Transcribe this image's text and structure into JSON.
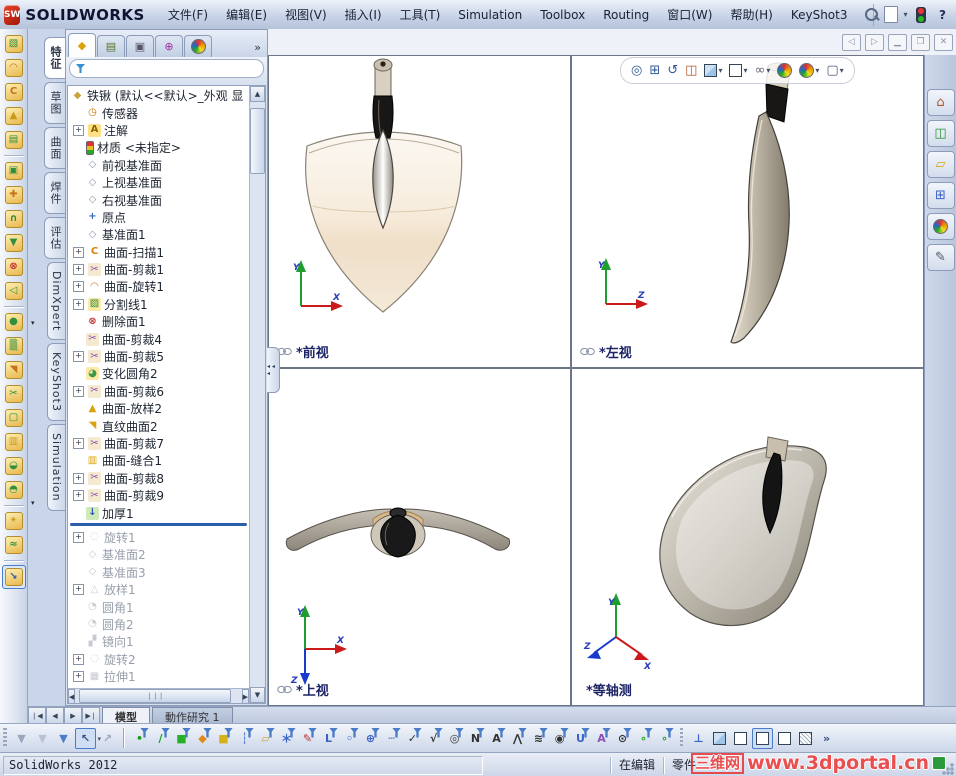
{
  "titlebar": {
    "logo_text": "SW",
    "brand": "SOLIDWORKS",
    "menus": [
      "文件(F)",
      "编辑(E)",
      "视图(V)",
      "插入(I)",
      "工具(T)",
      "Simulation",
      "Toolbox",
      "Routing",
      "窗口(W)",
      "帮助(H)",
      "KeyShot3"
    ],
    "quick_icons": [
      "search",
      "new-document",
      "connection-status",
      "help"
    ],
    "window_buttons": [
      "minimize",
      "restore",
      "close"
    ]
  },
  "command_tabs": {
    "items": [
      {
        "label": "特征",
        "active": true
      },
      {
        "label": "草图",
        "active": false
      },
      {
        "label": "曲面",
        "active": false
      },
      {
        "label": "焊件",
        "active": false
      },
      {
        "label": "评估",
        "active": false
      },
      {
        "label": "DimXpert",
        "active": false
      },
      {
        "label": "KeyShot3",
        "active": false
      },
      {
        "label": "Simulation",
        "active": false
      }
    ]
  },
  "manager_tabs": {
    "icons": [
      "featuremanager",
      "propertymanager",
      "configurationmanager",
      "dimxpertmanager",
      "displaymanager"
    ],
    "overflow": "»"
  },
  "filter": {
    "value": ""
  },
  "feature_tree": {
    "root": "铁锹  (默认<<默认>_外观 显",
    "rollback_index": 24,
    "items": [
      {
        "label": "传感器",
        "icon": "sensor"
      },
      {
        "label": "注解",
        "icon": "annotation",
        "expand": true
      },
      {
        "label": "材质 <未指定>",
        "icon": "material"
      },
      {
        "label": "前视基准面",
        "icon": "plane"
      },
      {
        "label": "上视基准面",
        "icon": "plane"
      },
      {
        "label": "右视基准面",
        "icon": "plane"
      },
      {
        "label": "原点",
        "icon": "origin"
      },
      {
        "label": "基准面1",
        "icon": "plane"
      },
      {
        "label": "曲面-扫描1",
        "icon": "sweep",
        "expand": true
      },
      {
        "label": "曲面-剪裁1",
        "icon": "trim",
        "expand": true
      },
      {
        "label": "曲面-旋转1",
        "icon": "revolve",
        "expand": true
      },
      {
        "label": "分割线1",
        "icon": "splitline",
        "expand": true
      },
      {
        "label": "删除面1",
        "icon": "delete-face"
      },
      {
        "label": "曲面-剪裁4",
        "icon": "trim"
      },
      {
        "label": "曲面-剪裁5",
        "icon": "trim",
        "expand": true
      },
      {
        "label": "变化圆角2",
        "icon": "fillet"
      },
      {
        "label": "曲面-剪裁6",
        "icon": "trim",
        "expand": true
      },
      {
        "label": "曲面-放样2",
        "icon": "loft"
      },
      {
        "label": "直纹曲面2",
        "icon": "ruled"
      },
      {
        "label": "曲面-剪裁7",
        "icon": "trim",
        "expand": true
      },
      {
        "label": "曲面-缝合1",
        "icon": "knit"
      },
      {
        "label": "曲面-剪裁8",
        "icon": "trim",
        "expand": true
      },
      {
        "label": "曲面-剪裁9",
        "icon": "trim",
        "expand": true
      },
      {
        "label": "加厚1",
        "icon": "thicken"
      },
      {
        "label": "旋转1",
        "icon": "revolve2",
        "expand": true,
        "gray": true
      },
      {
        "label": "基准面2",
        "icon": "plane",
        "gray": true
      },
      {
        "label": "基准面3",
        "icon": "plane",
        "gray": true
      },
      {
        "label": "放样1",
        "icon": "loft2",
        "expand": true,
        "gray": true
      },
      {
        "label": "圆角1",
        "icon": "fillet2",
        "gray": true
      },
      {
        "label": "圆角2",
        "icon": "fillet2",
        "gray": true
      },
      {
        "label": "镜向1",
        "icon": "mirror",
        "gray": true
      },
      {
        "label": "旋转2",
        "icon": "revolve2",
        "expand": true,
        "gray": true
      },
      {
        "label": "拉伸1",
        "icon": "extrude",
        "expand": true,
        "gray": true
      }
    ]
  },
  "viewports": {
    "front_label": "*前视",
    "left_label": "*左视",
    "top_label": "*上视",
    "iso_label": "*等轴测"
  },
  "headsup": {
    "icons": [
      {
        "name": "zoom-to-fit"
      },
      {
        "name": "zoom-to-area"
      },
      {
        "name": "previous-view"
      },
      {
        "name": "section-view"
      },
      {
        "name": "view-orientation",
        "caret": true
      },
      {
        "name": "display-style",
        "caret": true
      },
      {
        "name": "hide-show-items",
        "caret": true
      },
      {
        "name": "edit-appearance"
      },
      {
        "name": "apply-scene",
        "caret": true
      },
      {
        "name": "view-settings",
        "caret": true
      }
    ]
  },
  "taskpane": {
    "icons": [
      "solidworks-resources",
      "design-library",
      "file-explorer",
      "view-palette",
      "appearances-scenes",
      "custom-properties"
    ]
  },
  "left_toolbar": {
    "items": [
      "extruded-surface",
      "revolved-surface",
      "swept-surface",
      "lofted-surface",
      "boundary-surface",
      "|",
      "planar-surface",
      "offset-surface",
      "freeform",
      "replace-face",
      "delete-face",
      "extend-surface",
      "|",
      "filled-surface",
      "mid-surface",
      "ruled-surface",
      "trim-surface",
      "untrim-surface",
      "knit-surface",
      "thicken",
      "thickened-cut",
      "|",
      "split-line",
      "intersection-curve",
      "|",
      {
        "name": "measure",
        "pressed": true
      }
    ]
  },
  "bottom_toolbar": {
    "groups": [
      [
        "selection-filter-toggle",
        "clear-all-filters",
        "all-selection-filters",
        {
          "name": "select",
          "pressed": true,
          "caret": true
        },
        "magnified-selection"
      ],
      [
        "filter-vertices",
        "filter-edges",
        "filter-faces",
        "filter-surface-bodies",
        "filter-solid-bodies",
        "filter-axes",
        "filter-planes",
        "filter-sketch-points",
        "filter-sketches",
        "filter-sketch-segments",
        "filter-midpoints",
        "filter-center-marks",
        "filter-centerlines",
        "filter-dimensions",
        "filter-surface-finish-symbols",
        "filter-geometric-tolerances",
        "filter-notes",
        "filter-datums",
        "filter-weld-symbols",
        "filter-weld-beads",
        "filter-datum-targets",
        "filter-cosmetic-threads",
        "filter-blocks",
        "filter-dowel-pins",
        "filter-connection-points",
        "filter-routing-points"
      ],
      [
        "normal-to",
        "display-shaded",
        "display-shaded-with-edges",
        {
          "name": "display-hidden-lines-removed",
          "pressed": true
        },
        "display-hidden-lines-visible",
        "display-wireframe",
        "toolbar-overflow"
      ]
    ]
  },
  "doc_tabs": {
    "nav": [
      "first",
      "prev",
      "next",
      "last"
    ],
    "tabs": [
      {
        "label": "模型",
        "active": true
      },
      {
        "label": "動作研究 1",
        "active": false
      }
    ]
  },
  "statusbar": {
    "app": "SolidWorks 2012",
    "mode": "在编辑",
    "doctype": "零件"
  },
  "watermark": {
    "brand": "三维网",
    "url": "www.3dportal.cn"
  }
}
